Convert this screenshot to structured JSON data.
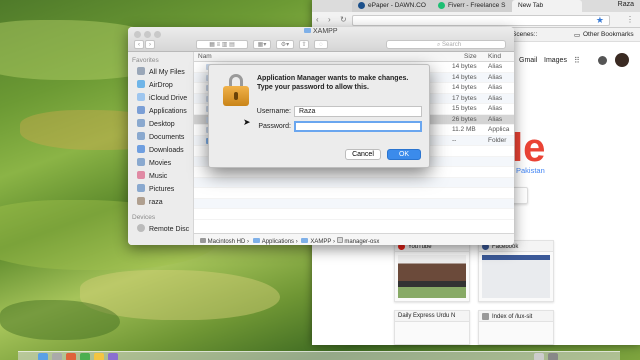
{
  "chrome": {
    "tabs": [
      {
        "label": "ePaper - DAWN.CO",
        "color": "#1b4f8a"
      },
      {
        "label": "Fiverr - Freelance S",
        "color": "#1dbf73"
      },
      {
        "label": "New Tab",
        "color": ""
      }
    ],
    "profile": "Raza",
    "bookmarks": {
      "scenes": "Scenes::",
      "other": "Other Bookmarks"
    },
    "top_links": {
      "gmail": "Gmail",
      "images": "Images"
    },
    "logo_fragment": "le",
    "country": "Pakistan",
    "tiles": [
      {
        "title": "YouTube"
      },
      {
        "title": "Facebook"
      },
      {
        "title": "Daily Express Urdu N"
      },
      {
        "title": "Index of /lux-sit"
      }
    ]
  },
  "finder": {
    "title": "XAMPP",
    "search_placeholder": "Search",
    "sidebar": {
      "favorites_header": "Favorites",
      "favorites": [
        {
          "label": "All My Files",
          "icon": "all-files-icon"
        },
        {
          "label": "AirDrop",
          "icon": "airdrop-icon"
        },
        {
          "label": "iCloud Drive",
          "icon": "cloud-icon"
        },
        {
          "label": "Applications",
          "icon": "applications-icon"
        },
        {
          "label": "Desktop",
          "icon": "desktop-icon"
        },
        {
          "label": "Documents",
          "icon": "documents-icon"
        },
        {
          "label": "Downloads",
          "icon": "downloads-icon"
        },
        {
          "label": "Movies",
          "icon": "movies-icon"
        },
        {
          "label": "Music",
          "icon": "music-icon"
        },
        {
          "label": "Pictures",
          "icon": "pictures-icon"
        },
        {
          "label": "raza",
          "icon": "home-icon"
        }
      ],
      "devices_header": "Devices",
      "devices": [
        {
          "label": "Remote Disc",
          "icon": "disc-icon"
        }
      ]
    },
    "columns": {
      "name": "Nam",
      "size": "Size",
      "kind": "Kind"
    },
    "rows": [
      {
        "size": "14 bytes",
        "kind": "Alias"
      },
      {
        "size": "14 bytes",
        "kind": "Alias"
      },
      {
        "size": "14 bytes",
        "kind": "Alias"
      },
      {
        "size": "17 bytes",
        "kind": "Alias"
      },
      {
        "size": "15 bytes",
        "kind": "Alias"
      },
      {
        "size": "26 bytes",
        "kind": "Alias"
      },
      {
        "size": "11.2 MB",
        "kind": "Applica"
      },
      {
        "size": "--",
        "kind": "Folder"
      }
    ],
    "path": [
      "Macintosh HD",
      "Applications",
      "XAMPP",
      "manager-osx"
    ]
  },
  "dialog": {
    "title": "Application Manager wants to make changes. Type your password to allow this.",
    "username_label": "Username:",
    "username_value": "Raza",
    "password_label": "Password:",
    "password_value": "",
    "cancel_label": "Cancel",
    "ok_label": "OK",
    "accent": "#3b8beb"
  }
}
